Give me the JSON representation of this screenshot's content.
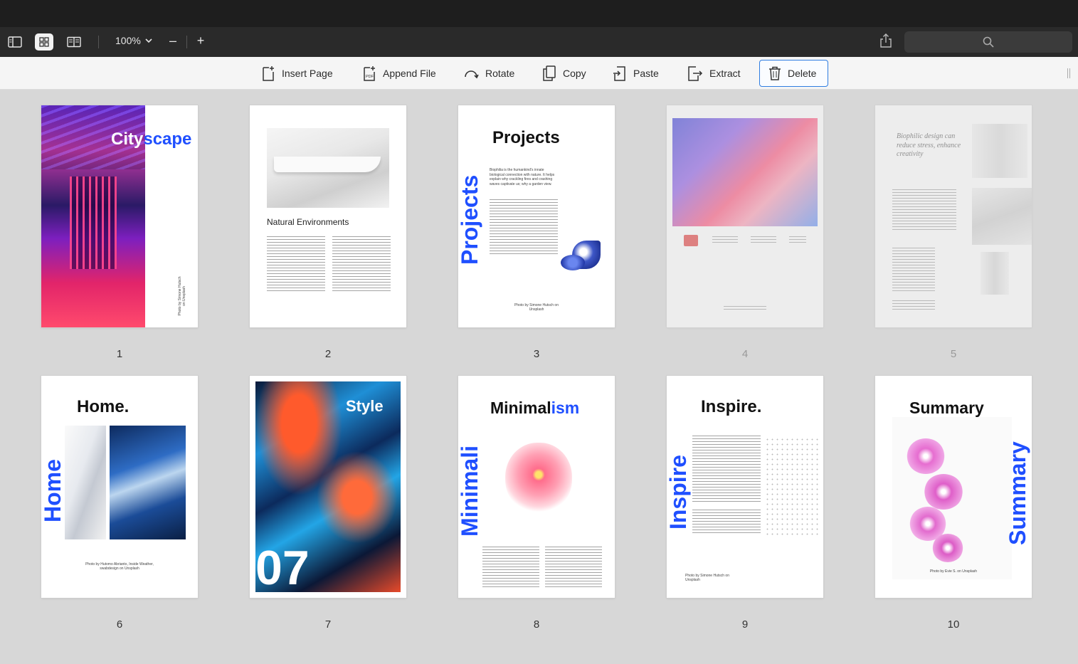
{
  "toolbar": {
    "zoom_value": "100%",
    "zoom_out_label": "–",
    "zoom_in_label": "+"
  },
  "edit_toolbar": {
    "items": [
      {
        "label": "Insert Page",
        "icon": "insert-page-icon"
      },
      {
        "label": "Append File",
        "icon": "append-pdf-icon"
      },
      {
        "label": "Rotate",
        "icon": "rotate-icon"
      },
      {
        "label": "Copy",
        "icon": "copy-icon"
      },
      {
        "label": "Paste",
        "icon": "paste-icon"
      },
      {
        "label": "Extract",
        "icon": "extract-icon"
      },
      {
        "label": "Delete",
        "icon": "trash-icon",
        "selected": true
      }
    ]
  },
  "colors": {
    "accent": "#2f7de1",
    "brand_blue": "#1f4fff",
    "dark_toolbar": "#2a2a2a",
    "canvas": "#d7d7d7"
  },
  "pages": [
    {
      "number": "1",
      "title": "Cityscape",
      "caption": "Photo by Simone Hutsch on Unsplash"
    },
    {
      "number": "2",
      "title": "Natural Environments"
    },
    {
      "number": "3",
      "title": "Projects",
      "side_title": "Projects",
      "body": "Biophilia is the humankind's innate biological connection with nature. It helps explain why crackling fires and crashing waves captivate us; why a garden view.",
      "caption": "Photo by Simone Hutsch on Unsplash"
    },
    {
      "number": "4",
      "title": "",
      "faded": true
    },
    {
      "number": "5",
      "title": "Biophilic design can reduce stress, enhance creativity",
      "faded": true
    },
    {
      "number": "6",
      "title": "Home.",
      "side_title": "Home",
      "caption": "Photo by Hutomo Abrianto, Inside Weather, swabdesign on Unsplash"
    },
    {
      "number": "7",
      "title": "Style",
      "big_number": "07"
    },
    {
      "number": "8",
      "title": "Minimalism",
      "side_title": "Minimali"
    },
    {
      "number": "9",
      "title": "Inspire.",
      "side_title": "Inspire",
      "caption": "Photo by Simone Hutsch on Unsplash"
    },
    {
      "number": "10",
      "title": "Summary",
      "side_title": "Summary",
      "caption": "Photo by Evie S. on Unsplash"
    }
  ]
}
